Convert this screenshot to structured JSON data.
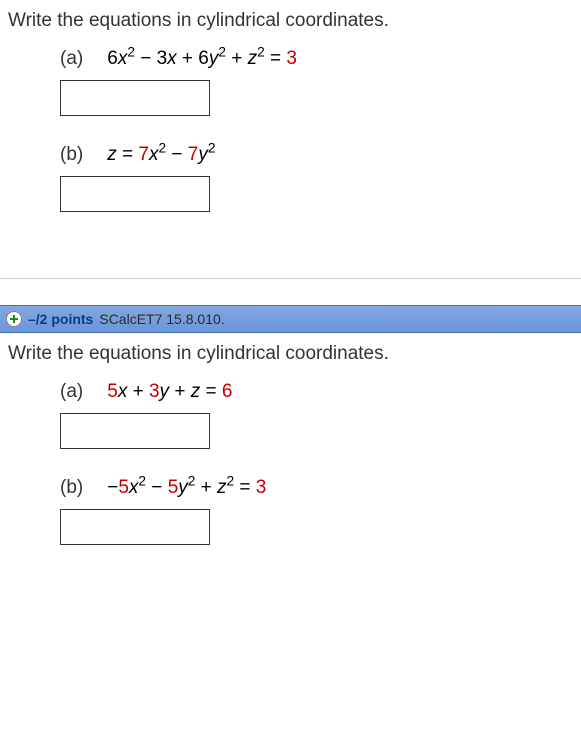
{
  "q1": {
    "prompt": "Write the equations in cylindrical coordinates.",
    "a": {
      "label": "(a)",
      "eq_html": "6<i>x</i><sup>2</sup> − 3<i>x</i> + 6<i>y</i><sup>2</sup> + <i>z</i><sup>2</sup> = <span class=\"equation-red\">3</span>"
    },
    "b": {
      "label": "(b)",
      "eq_html": "<i>z</i> = <span class=\"equation-red\">7</span><i>x</i><sup>2</sup> − <span class=\"equation-red\">7</span><i>y</i><sup>2</sup>"
    }
  },
  "header": {
    "points": "–/2 points",
    "source": "SCalcET7 15.8.010."
  },
  "q2": {
    "prompt": "Write the equations in cylindrical coordinates.",
    "a": {
      "label": "(a)",
      "eq_html": "<span class=\"equation-red\">5</span><i>x</i> + <span class=\"equation-red\">3</span><i>y</i> + <i>z</i> = <span class=\"equation-red\">6</span>"
    },
    "b": {
      "label": "(b)",
      "eq_html": "−<span class=\"equation-red\">5</span><i>x</i><sup>2</sup> − <span class=\"equation-red\">5</span><i>y</i><sup>2</sup> + <i>z</i><sup>2</sup> = <span class=\"equation-red\">3</span>"
    }
  }
}
